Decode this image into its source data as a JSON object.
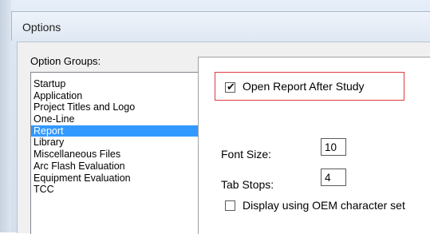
{
  "window": {
    "title": "Options"
  },
  "option_groups": {
    "label": "Option Groups:",
    "items": [
      {
        "label": "Startup",
        "selected": false
      },
      {
        "label": "Application",
        "selected": false
      },
      {
        "label": "Project Titles and Logo",
        "selected": false
      },
      {
        "label": "One-Line",
        "selected": false
      },
      {
        "label": "Report",
        "selected": true
      },
      {
        "label": "Library",
        "selected": false
      },
      {
        "label": "Miscellaneous Files",
        "selected": false
      },
      {
        "label": "Arc Flash Evaluation",
        "selected": false
      },
      {
        "label": "Equipment Evaluation",
        "selected": false
      },
      {
        "label": "TCC",
        "selected": false
      }
    ]
  },
  "report_settings": {
    "open_report_after_study": {
      "label": "Open Report After Study",
      "checked": true
    },
    "font_size": {
      "label": "Font Size:",
      "value": "10"
    },
    "tab_stops": {
      "label": "Tab Stops:",
      "value": "4"
    },
    "display_oem": {
      "label": "Display using OEM character set",
      "checked": false
    }
  },
  "colors": {
    "selection": "#3399ff",
    "highlight_border": "#e03a3e",
    "dialog_background": "#f0f0f0"
  }
}
